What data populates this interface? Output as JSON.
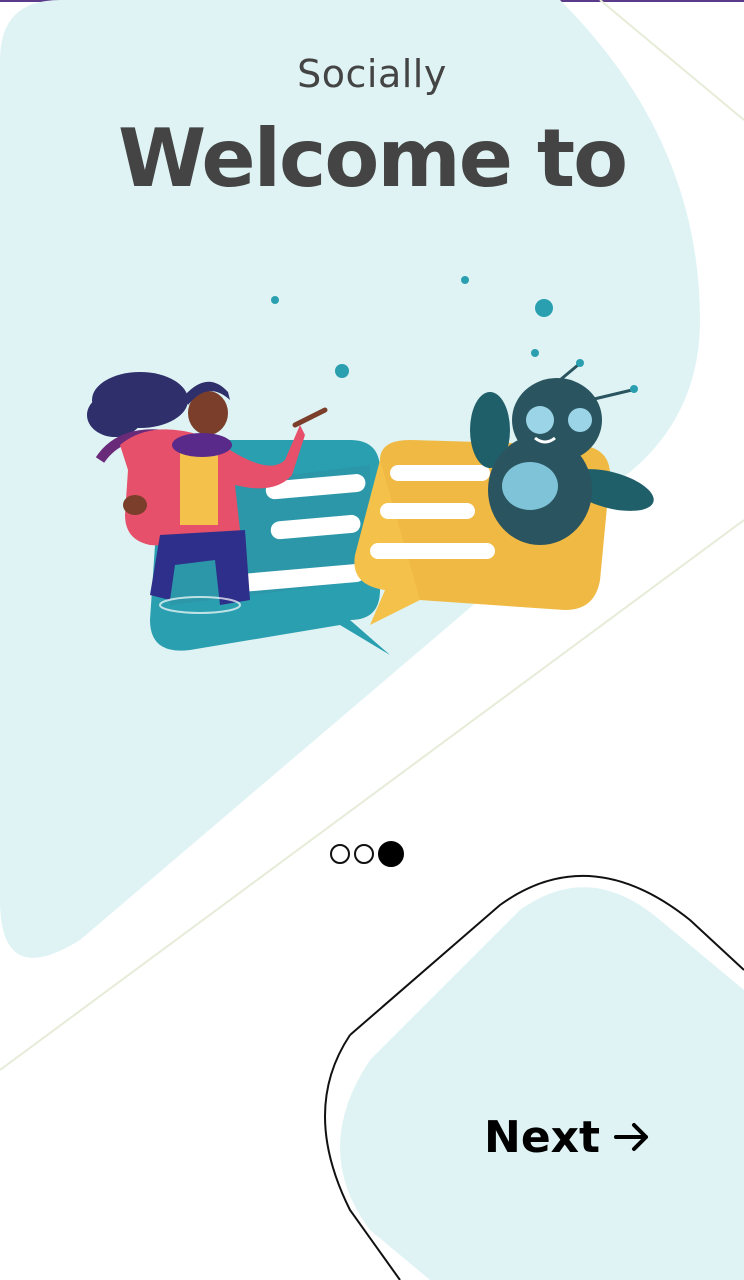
{
  "onboarding": {
    "subtitle": "Socially",
    "headline": "Welcome to",
    "illustration_icon": "chat-with-robot-illustration",
    "page_indicator": {
      "total": 3,
      "active_index": 2
    },
    "next_label": "Next",
    "next_icon": "arrow-right-icon"
  },
  "colors": {
    "accent_bg": "#dff3f4",
    "text_dark": "#444444",
    "teal": "#2a9fb0",
    "yellow": "#f4c24a"
  }
}
